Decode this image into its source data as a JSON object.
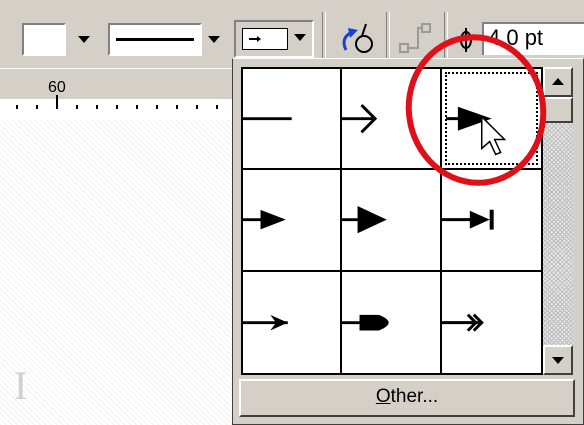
{
  "toolbar": {
    "line_weight_value": "4.0 pt",
    "fill_swatch_color": "#ffffff",
    "icons": [
      "fill-dropdown-icon",
      "line-style-icon",
      "arrow-style-icon",
      "line-color-icon",
      "connector-icon",
      "line-weight-icon"
    ]
  },
  "ruler": {
    "label": "60"
  },
  "arrow_menu": {
    "cells": [
      {
        "name": "no-arrow",
        "selected": false
      },
      {
        "name": "open-arrow",
        "selected": false
      },
      {
        "name": "filled-arrow-large",
        "selected": true
      },
      {
        "name": "filled-arrow-small",
        "selected": false
      },
      {
        "name": "filled-arrow-medium",
        "selected": false
      },
      {
        "name": "arrow-with-bar",
        "selected": false
      },
      {
        "name": "open-arrow-bold",
        "selected": false
      },
      {
        "name": "rounded-block-arrow",
        "selected": false
      },
      {
        "name": "double-arrow",
        "selected": false
      }
    ],
    "other_button": {
      "first": "O",
      "rest": "ther..."
    }
  },
  "colors": {
    "highlight": "#e0101a",
    "chrome": "#d4d0c8",
    "accent_blue": "#1a3fd1"
  }
}
